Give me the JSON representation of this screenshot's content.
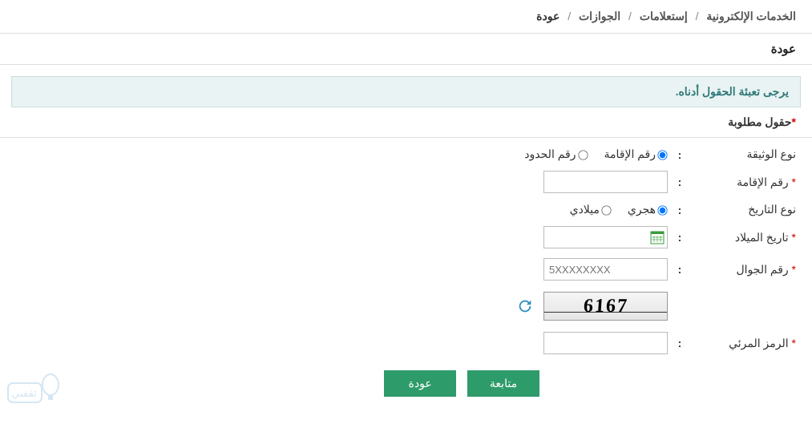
{
  "breadcrumb": {
    "item1": "الخدمات الإلكترونية",
    "item2": "إستعلامات",
    "item3": "الجوازات",
    "current": "عودة"
  },
  "panel_title": "عودة",
  "info_message": "يرجى تعبئة الحقول أدناه.",
  "required_note": "حقول مطلوبة",
  "labels": {
    "document_type": "نوع الوثيقة",
    "iqama_number": "رقم الإقامة",
    "date_type": "نوع التاريخ",
    "birth_date": "تاريخ الميلاد",
    "mobile": "رقم الجوال",
    "captcha": "الرمز المرئي"
  },
  "options": {
    "doc_iqama": "رقم الإقامة",
    "doc_border": "رقم الحدود",
    "date_hijri": "هجري",
    "date_gregorian": "ميلادي"
  },
  "placeholders": {
    "mobile": "5XXXXXXXX"
  },
  "captcha_value": "6167",
  "buttons": {
    "continue": "متابعة",
    "back": "عودة"
  },
  "watermark": "ثقفني"
}
